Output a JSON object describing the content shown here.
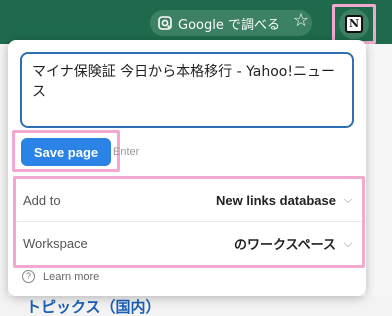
{
  "browser": {
    "google_pill_label": "Google で調べる",
    "lens_icon": "google-lens-icon",
    "star_icon": "bookmark-star-icon",
    "extension_icon": "notion-icon",
    "extension_logo_letter": "N"
  },
  "background_page": {
    "topics_heading": "トピックス（国内）"
  },
  "popup": {
    "title_value": "マイナ保険証 今日から本格移行 - Yahoo!ニュース",
    "save_label": "Save page",
    "enter_hint": "Enter",
    "options": [
      {
        "label": "Add to",
        "value": "New links database"
      },
      {
        "label": "Workspace",
        "value": "のワークスペース"
      }
    ],
    "learn_more": "Learn more"
  },
  "colors": {
    "chrome": "#1f6a4d",
    "accent_blue": "#2a83e5",
    "highlight_pink": "#f2a9cf"
  }
}
